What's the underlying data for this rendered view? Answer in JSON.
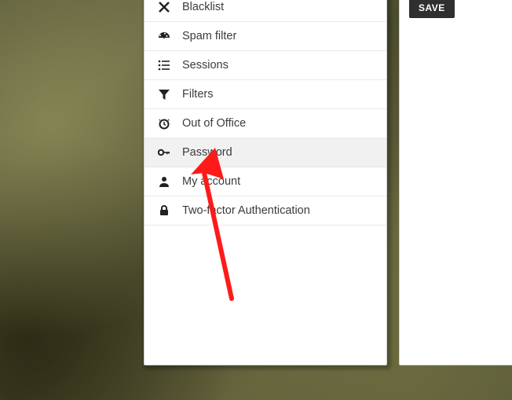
{
  "sidebar": {
    "items": [
      {
        "icon": "x-icon",
        "label": "Blacklist",
        "selected": false
      },
      {
        "icon": "gauge-icon",
        "label": "Spam filter",
        "selected": false
      },
      {
        "icon": "list-icon",
        "label": "Sessions",
        "selected": false
      },
      {
        "icon": "funnel-icon",
        "label": "Filters",
        "selected": false
      },
      {
        "icon": "clock-icon",
        "label": "Out of Office",
        "selected": false
      },
      {
        "icon": "key-icon",
        "label": "Password",
        "selected": true
      },
      {
        "icon": "person-icon",
        "label": "My account",
        "selected": false
      },
      {
        "icon": "lock-icon",
        "label": "Two-factor Authentication",
        "selected": false
      }
    ]
  },
  "actions": {
    "save_label": "SAVE"
  },
  "annotation": {
    "arrow_color": "#ff1a1a",
    "points_to": "password-menu-item"
  }
}
